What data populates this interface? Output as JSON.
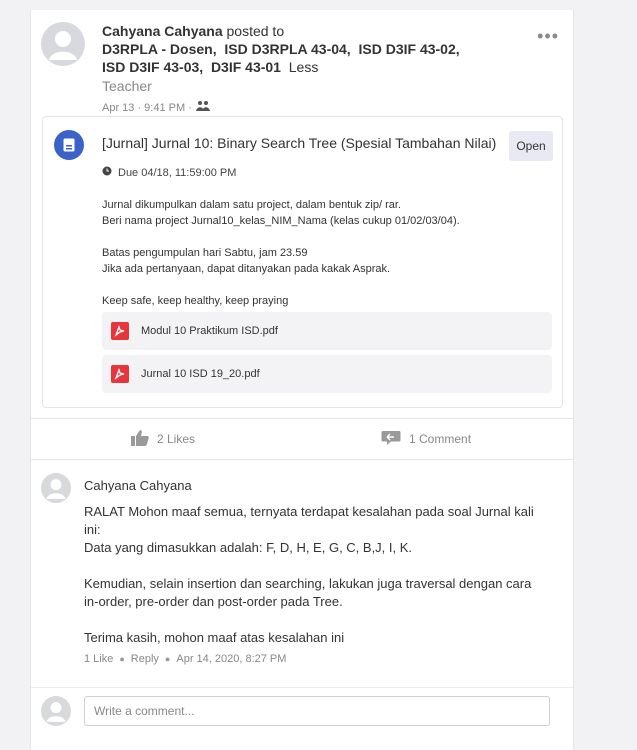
{
  "post": {
    "author": "Cahyana Cahyana",
    "posted_to": "posted to",
    "recipients": [
      "D3RPLA - Dosen,",
      "ISD D3RPLA 43-04,",
      "ISD D3IF 43-02,",
      "ISD D3IF 43-03,",
      "D3IF 43-01"
    ],
    "less_label": "Less",
    "role": "Teacher",
    "date": "Apr 13 · 9:41 PM ·",
    "more_icon": "more-horizontal-icon"
  },
  "assignment": {
    "title": "[Jurnal] Jurnal 10: Binary Search Tree (Spesial Tambahan Nilai)",
    "open_label": "Open",
    "due": "Due 04/18, 11:59:00 PM",
    "description": [
      "Jurnal dikumpulkan dalam satu project, dalam bentuk zip/ rar.",
      "Beri nama project Jurnal10_kelas_NIM_Nama (kelas cukup 01/02/03/04).",
      "",
      "Batas pengumpulan hari Sabtu, jam 23.59",
      "Jika ada pertanyaan, dapat ditanyakan pada kakak Asprak.",
      "",
      "Keep safe, keep healthy, keep praying"
    ],
    "attachments": [
      "Modul 10 Praktikum ISD.pdf",
      "Jurnal 10 ISD 19_20.pdf"
    ],
    "accent": "#3a62c9"
  },
  "actions": {
    "likes": "2 Likes",
    "comments": "1 Comment"
  },
  "comment": {
    "author": "Cahyana Cahyana",
    "body": [
      "RALAT Mohon maaf semua, ternyata terdapat kesalahan pada soal Jurnal kali ini:",
      "Data yang dimasukkan adalah: F, D, H, E, G, C, B,J, I, K.",
      "",
      "Kemudian, selain insertion dan searching, lakukan juga traversal dengan cara in-order, pre-order dan post-order pada Tree.",
      "",
      "Terima kasih, mohon maaf atas kesalahan ini"
    ],
    "like": "1 Like",
    "reply": "Reply",
    "date": "Apr 14, 2020, 8:27 PM"
  },
  "write_comment": {
    "placeholder": "Write a comment..."
  }
}
